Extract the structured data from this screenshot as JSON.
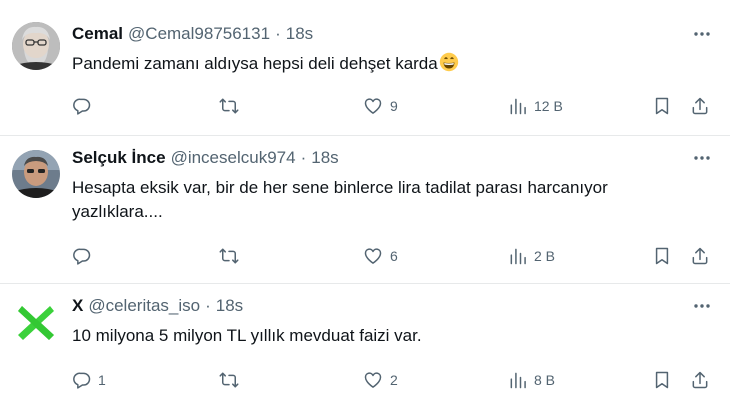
{
  "tweets": [
    {
      "display_name": "Cemal",
      "handle": "@Cemal98756131",
      "separator": "·",
      "time": "18s",
      "text": "Pandemi zamanı aldıysa hepsi deli dehşet karda",
      "emoji": "grinning-face-emoji",
      "avatar": "photo-avatar-gray-hair",
      "replies": "",
      "retweets": "",
      "likes": "9",
      "views": "12 B"
    },
    {
      "display_name": "Selçuk İnce",
      "handle": "@inceselcuk974",
      "separator": "·",
      "time": "18s",
      "text": "Hesapta eksik var, bir de her sene binlerce lira tadilat parası harcanıyor yazlıklara....",
      "avatar": "photo-avatar-man",
      "replies": "",
      "retweets": "",
      "likes": "6",
      "views": "2 B"
    },
    {
      "display_name": "X",
      "handle": "@celeritas_iso",
      "separator": "·",
      "time": "18s",
      "text": "10 milyona 5 milyon TL yıllık mevduat faizi var.",
      "avatar": "green-x-avatar",
      "replies": "1",
      "retweets": "",
      "likes": "2",
      "views": "8 B"
    }
  ],
  "icons": {
    "reply": "reply-icon",
    "retweet": "retweet-icon",
    "like": "heart-icon",
    "views": "views-icon",
    "bookmark": "bookmark-icon",
    "share": "share-icon",
    "more": "more-icon"
  },
  "colors": {
    "text": "#0f1419",
    "secondary": "#536471",
    "divider": "#e7e9ea",
    "green_x": "#3bd13b"
  }
}
